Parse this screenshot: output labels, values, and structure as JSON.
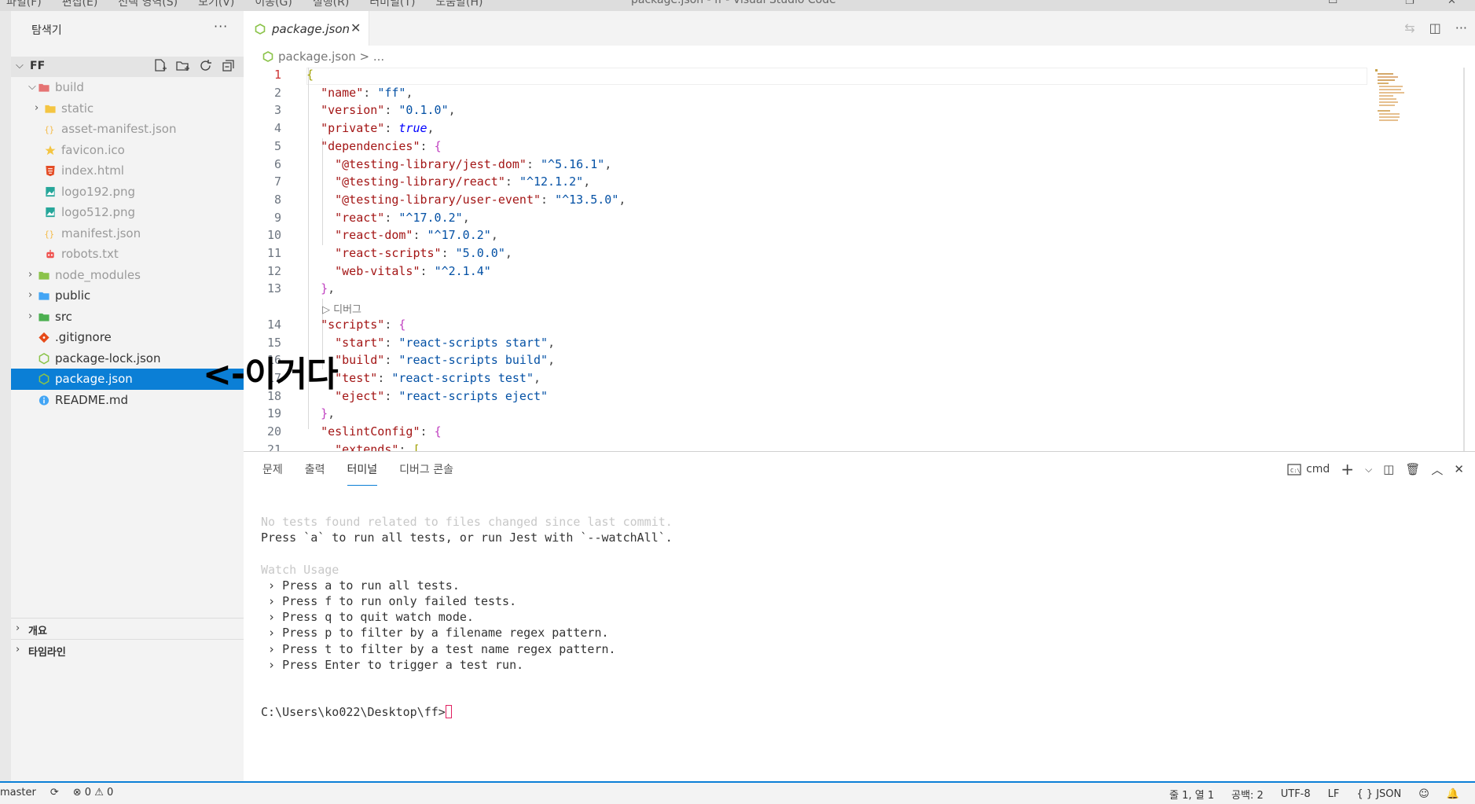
{
  "titlebar": {
    "menus": [
      "파일(F)",
      "편집(E)",
      "선택 영역(S)",
      "보기(V)",
      "이동(G)",
      "실행(R)",
      "터미널(T)",
      "도움말(H)"
    ],
    "title": "package.json - ff - Visual Studio Code"
  },
  "sidebar": {
    "title": "탐색기",
    "root": "FF",
    "tree": [
      {
        "label": "build",
        "depth": 0,
        "type": "folder-open",
        "dim": true
      },
      {
        "label": "static",
        "depth": 1,
        "type": "folder",
        "dim": true
      },
      {
        "label": "asset-manifest.json",
        "depth": 1,
        "type": "json",
        "dim": true
      },
      {
        "label": "favicon.ico",
        "depth": 1,
        "type": "star",
        "dim": true
      },
      {
        "label": "index.html",
        "depth": 1,
        "type": "html",
        "dim": true
      },
      {
        "label": "logo192.png",
        "depth": 1,
        "type": "image",
        "dim": true
      },
      {
        "label": "logo512.png",
        "depth": 1,
        "type": "image",
        "dim": true
      },
      {
        "label": "manifest.json",
        "depth": 1,
        "type": "json",
        "dim": true
      },
      {
        "label": "robots.txt",
        "depth": 1,
        "type": "robot",
        "dim": true
      },
      {
        "label": "node_modules",
        "depth": 0,
        "type": "folder-green",
        "dim": true
      },
      {
        "label": "public",
        "depth": 0,
        "type": "folder-blue",
        "dim": false
      },
      {
        "label": "src",
        "depth": 0,
        "type": "folder-src",
        "dim": false
      },
      {
        "label": ".gitignore",
        "depth": 0,
        "type": "git",
        "dim": false
      },
      {
        "label": "package-lock.json",
        "depth": 0,
        "type": "npm",
        "dim": false
      },
      {
        "label": "package.json",
        "depth": 0,
        "type": "npm",
        "dim": false,
        "selected": true
      },
      {
        "label": "README.md",
        "depth": 0,
        "type": "info",
        "dim": false
      }
    ],
    "sections": [
      "개요",
      "타임라인"
    ]
  },
  "annotation": "<-이거다",
  "editor": {
    "tab_label": "package.json",
    "breadcrumb": "package.json > ...",
    "fold_hint": "▷ 디버그",
    "lines": [
      {
        "n": "1",
        "t": [
          [
            "br",
            "{"
          ]
        ]
      },
      {
        "n": "2",
        "t": [
          [
            "p",
            "  "
          ],
          [
            "k",
            "\"name\""
          ],
          [
            "p",
            ": "
          ],
          [
            "s",
            "\"ff\""
          ],
          [
            "p",
            ","
          ]
        ]
      },
      {
        "n": "3",
        "t": [
          [
            "p",
            "  "
          ],
          [
            "k",
            "\"version\""
          ],
          [
            "p",
            ": "
          ],
          [
            "s",
            "\"0.1.0\""
          ],
          [
            "p",
            ","
          ]
        ]
      },
      {
        "n": "4",
        "t": [
          [
            "p",
            "  "
          ],
          [
            "k",
            "\"private\""
          ],
          [
            "p",
            ": "
          ],
          [
            "b",
            "true"
          ],
          [
            "p",
            ","
          ]
        ]
      },
      {
        "n": "5",
        "t": [
          [
            "p",
            "  "
          ],
          [
            "k",
            "\"dependencies\""
          ],
          [
            "p",
            ": "
          ],
          [
            "br2",
            "{"
          ]
        ]
      },
      {
        "n": "6",
        "t": [
          [
            "p",
            "    "
          ],
          [
            "k",
            "\"@testing-library/jest-dom\""
          ],
          [
            "p",
            ": "
          ],
          [
            "s",
            "\"^5.16.1\""
          ],
          [
            "p",
            ","
          ]
        ]
      },
      {
        "n": "7",
        "t": [
          [
            "p",
            "    "
          ],
          [
            "k",
            "\"@testing-library/react\""
          ],
          [
            "p",
            ": "
          ],
          [
            "s",
            "\"^12.1.2\""
          ],
          [
            "p",
            ","
          ]
        ]
      },
      {
        "n": "8",
        "t": [
          [
            "p",
            "    "
          ],
          [
            "k",
            "\"@testing-library/user-event\""
          ],
          [
            "p",
            ": "
          ],
          [
            "s",
            "\"^13.5.0\""
          ],
          [
            "p",
            ","
          ]
        ]
      },
      {
        "n": "9",
        "t": [
          [
            "p",
            "    "
          ],
          [
            "k",
            "\"react\""
          ],
          [
            "p",
            ": "
          ],
          [
            "s",
            "\"^17.0.2\""
          ],
          [
            "p",
            ","
          ]
        ]
      },
      {
        "n": "10",
        "t": [
          [
            "p",
            "    "
          ],
          [
            "k",
            "\"react-dom\""
          ],
          [
            "p",
            ": "
          ],
          [
            "s",
            "\"^17.0.2\""
          ],
          [
            "p",
            ","
          ]
        ]
      },
      {
        "n": "11",
        "t": [
          [
            "p",
            "    "
          ],
          [
            "k",
            "\"react-scripts\""
          ],
          [
            "p",
            ": "
          ],
          [
            "s",
            "\"5.0.0\""
          ],
          [
            "p",
            ","
          ]
        ]
      },
      {
        "n": "12",
        "t": [
          [
            "p",
            "    "
          ],
          [
            "k",
            "\"web-vitals\""
          ],
          [
            "p",
            ": "
          ],
          [
            "s",
            "\"^2.1.4\""
          ]
        ]
      },
      {
        "n": "13",
        "t": [
          [
            "p",
            "  "
          ],
          [
            "br2",
            "}"
          ],
          [
            "p",
            ","
          ]
        ]
      },
      {
        "n": "",
        "fold": true
      },
      {
        "n": "14",
        "t": [
          [
            "p",
            "  "
          ],
          [
            "k",
            "\"scripts\""
          ],
          [
            "p",
            ": "
          ],
          [
            "br2",
            "{"
          ]
        ]
      },
      {
        "n": "15",
        "t": [
          [
            "p",
            "    "
          ],
          [
            "k",
            "\"start\""
          ],
          [
            "p",
            ": "
          ],
          [
            "s",
            "\"react-scripts start\""
          ],
          [
            "p",
            ","
          ]
        ]
      },
      {
        "n": "16",
        "t": [
          [
            "p",
            "    "
          ],
          [
            "k",
            "\"build\""
          ],
          [
            "p",
            ": "
          ],
          [
            "s",
            "\"react-scripts build\""
          ],
          [
            "p",
            ","
          ]
        ]
      },
      {
        "n": "17",
        "t": [
          [
            "p",
            "    "
          ],
          [
            "k",
            "\"test\""
          ],
          [
            "p",
            ": "
          ],
          [
            "s",
            "\"react-scripts test\""
          ],
          [
            "p",
            ","
          ]
        ]
      },
      {
        "n": "18",
        "t": [
          [
            "p",
            "    "
          ],
          [
            "k",
            "\"eject\""
          ],
          [
            "p",
            ": "
          ],
          [
            "s",
            "\"react-scripts eject\""
          ]
        ]
      },
      {
        "n": "19",
        "t": [
          [
            "p",
            "  "
          ],
          [
            "br2",
            "}"
          ],
          [
            "p",
            ","
          ]
        ]
      },
      {
        "n": "20",
        "t": [
          [
            "p",
            "  "
          ],
          [
            "k",
            "\"eslintConfig\""
          ],
          [
            "p",
            ": "
          ],
          [
            "br2",
            "{"
          ]
        ]
      },
      {
        "n": "21",
        "t": [
          [
            "p",
            "    "
          ],
          [
            "k",
            "\"extends\""
          ],
          [
            "p",
            ": "
          ],
          [
            "br",
            "["
          ]
        ]
      }
    ]
  },
  "panel": {
    "tabs": [
      "문제",
      "출력",
      "터미널",
      "디버그 콘솔"
    ],
    "active_tab": "터미널",
    "shell": "cmd",
    "terminal": [
      {
        "t": "No tests found related to files changed since last commit.",
        "dim": true
      },
      {
        "t": "Press `a` to run all tests, or run Jest with `--watchAll`."
      },
      {
        "t": ""
      },
      {
        "t": "Watch Usage",
        "dim": true
      },
      {
        "t": " › Press a to run all tests."
      },
      {
        "t": " › Press f to run only failed tests."
      },
      {
        "t": " › Press q to quit watch mode."
      },
      {
        "t": " › Press p to filter by a filename regex pattern."
      },
      {
        "t": " › Press t to filter by a test name regex pattern."
      },
      {
        "t": " › Press Enter to trigger a test run."
      },
      {
        "t": ""
      },
      {
        "t": ""
      },
      {
        "t": "C:\\Users\\ko022\\Desktop\\ff>",
        "prompt": true
      }
    ]
  },
  "statusbar": {
    "branch": "master",
    "errors": "0",
    "warnings": "0",
    "position": "줄 1, 열 1",
    "indent": "공백: 2",
    "encoding": "UTF-8",
    "eol": "LF",
    "language": "JSON"
  }
}
